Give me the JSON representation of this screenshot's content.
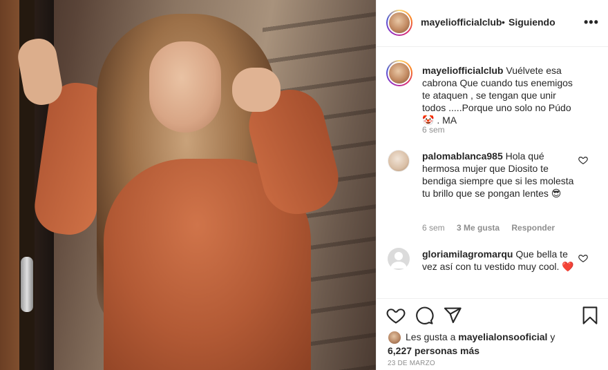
{
  "post": {
    "username": "mayeliofficialclub",
    "separator": "•",
    "follow_status": "Siguiendo",
    "more_label": "•••"
  },
  "caption": {
    "username": "mayeliofficialclub",
    "text": "Vuélvete esa cabrona Que cuando tus enemigos te ataquen , se tengan que unir todos .....Porque uno solo no Púdo 🤡 . MA",
    "time": "6 sem"
  },
  "comments": [
    {
      "username": "palomablanca985",
      "text": "Hola qué hermosa mujer que Diosito te bendiga siempre que si les molesta tu brillo que se pongan lentes 😎",
      "time": "6 sem",
      "likes": "3 Me gusta",
      "reply": "Responder"
    },
    {
      "username": "gloriamilagromarqu",
      "text": "Que bella te vez así con tu vestido muy cool. ❤️"
    }
  ],
  "likes": {
    "prefix": "Les gusta a",
    "user": "mayelialonsooficial",
    "joiner": "y",
    "others": "6,227 personas más"
  },
  "date": "23 DE MARZO",
  "icons": {
    "like": "heart-icon",
    "comment": "comment-icon",
    "share": "paper-plane-icon",
    "save": "bookmark-icon",
    "more": "ellipsis-icon"
  }
}
